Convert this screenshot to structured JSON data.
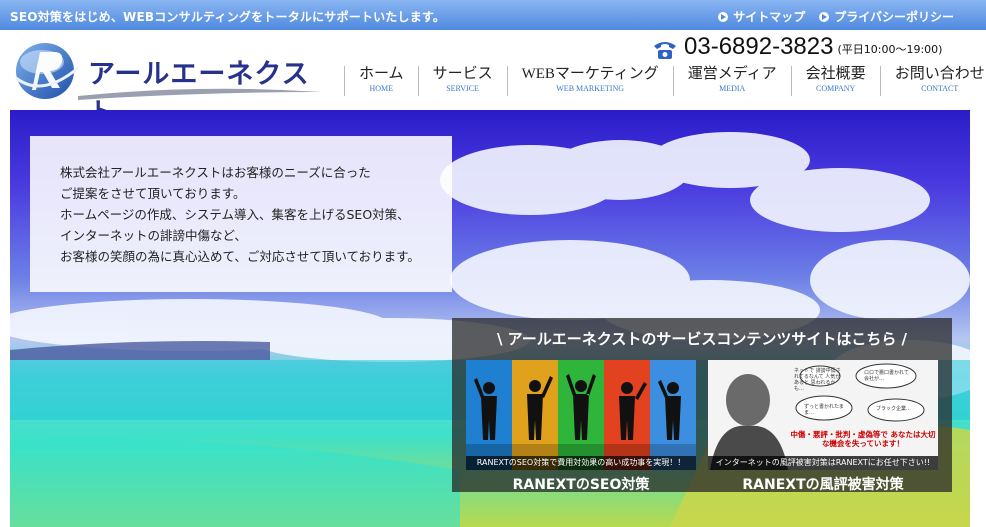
{
  "topbar": {
    "tagline": "SEO対策をはじめ、WEBコンサルティングをトータルにサポートいたします。",
    "links": [
      "サイトマップ",
      "プライバシーポリシー"
    ]
  },
  "header": {
    "logo_text": "アールエーネクスト",
    "phone": "03-6892-3823",
    "phone_hours": "(平日10:00〜19:00)"
  },
  "nav": [
    {
      "label": "ホーム",
      "sub": "HOME"
    },
    {
      "label": "サービス",
      "sub": "SERVICE"
    },
    {
      "label": "WEBマーケティング",
      "sub": "WEB MARKETING"
    },
    {
      "label": "運営メディア",
      "sub": "MEDIA"
    },
    {
      "label": "会社概要",
      "sub": "COMPANY"
    },
    {
      "label": "お問い合わせ",
      "sub": "CONTACT"
    }
  ],
  "intro": {
    "lines": [
      "株式会社アールエーネクストはお客様のニーズに合った",
      "ご提案をさせて頂いております。",
      "ホームページの作成、システム導入、集客を上げるSEO対策、",
      "インターネットの誹謗中傷など、",
      "お客様の笑顔の為に真心込めて、ご対応させて頂いております。"
    ]
  },
  "services": {
    "title": "\\ アールエーネクストのサービスコンテンツサイトはこちら /",
    "cards": [
      {
        "caption": "RANEXTのSEO対策で費用対効果の高い成功事を実現！！",
        "label": "RANEXTのSEO対策"
      },
      {
        "caption": "インターネットの風評被害対策はRANEXTにお任せ下さい!!",
        "label": "RANEXTの風評被害対策",
        "banner": "中傷・悪評・批判・虚偽等で あなたは大切な機会を失っています！",
        "bubbles": [
          "ネットで 誹謗中傷されてるなんて 人気があると 思われるかも…",
          "ロロで悪口書かれて 会社が…",
          "ずっと書かれたまま…",
          "ブラック企業…"
        ]
      }
    ]
  },
  "colors": {
    "topbar": "#4f89df",
    "logo": "#27328c",
    "nav_sub": "#3a78c8"
  }
}
